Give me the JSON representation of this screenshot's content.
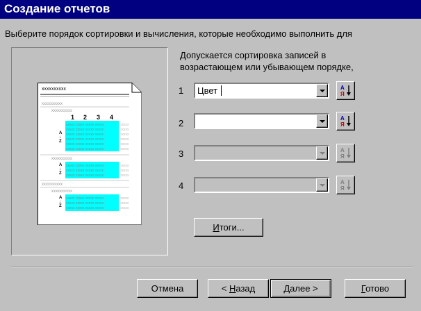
{
  "window": {
    "title": "Создание отчетов"
  },
  "instruction": "Выберите порядок сортировки и вычисления, которые необходимо выполнить для",
  "help_line1": "Допускается сортировка записей в",
  "help_line2": "возрастающем или убывающем порядке,",
  "preview": {
    "placeholder": "xxxxxxxxxx",
    "columns": [
      "1",
      "2",
      "3",
      "4"
    ],
    "accent_color": "#00ffff"
  },
  "sort_rows": [
    {
      "number": "1",
      "value": "Цвет",
      "enabled": true,
      "sort_icon": "sort-ascending-icon"
    },
    {
      "number": "2",
      "value": "",
      "enabled": true,
      "sort_icon": "sort-ascending-icon"
    },
    {
      "number": "3",
      "value": "",
      "enabled": false,
      "sort_icon": "sort-ascending-icon"
    },
    {
      "number": "4",
      "value": "",
      "enabled": false,
      "sort_icon": "sort-ascending-icon"
    }
  ],
  "buttons": {
    "summary_prefix": "",
    "summary_mnemonic": "И",
    "summary_rest": "тоги...",
    "cancel": "Отмена",
    "back_arrow": "<",
    "back_mnemonic": "Н",
    "back_rest": "азад",
    "next_mnemonic": "Д",
    "next_rest": "алее >",
    "finish_mnemonic": "Г",
    "finish_rest": "отово"
  }
}
